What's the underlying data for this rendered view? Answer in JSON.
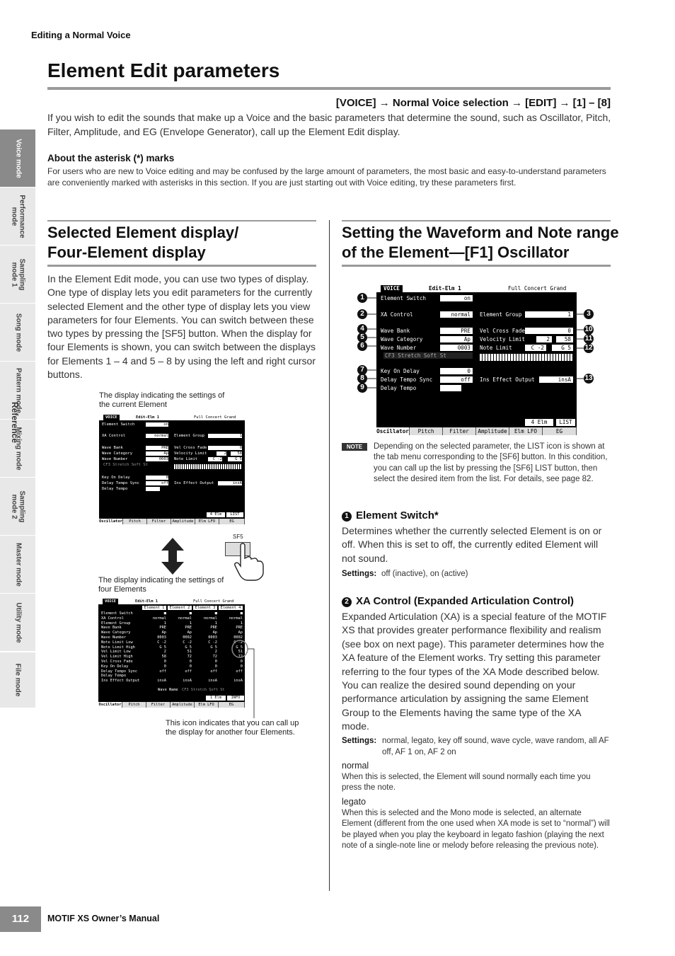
{
  "running_head": "Editing a Normal Voice",
  "title": "Element Edit parameters",
  "nav_path": "[VOICE] → Normal Voice selection → [EDIT] → [1] – [8]",
  "intro": "If you wish to edit the sounds that make up a Voice and the basic parameters that determine the sound, such as Oscillator, Pitch, Filter, Amplitude, and EG (Envelope Generator), call up the Element Edit display.",
  "asterisk": {
    "heading": "About the asterisk (*) marks",
    "body": "For users who are new to Voice editing and may be confused by the large amount of parameters, the most basic and easy-to-understand parameters are conveniently marked with asterisks in this section. If you are just starting out with Voice editing, try these parameters first."
  },
  "side_tabs": [
    "Voice mode",
    "Performance\nmode",
    "Sampling\nmode 1",
    "Song mode",
    "Pattern mode",
    "Mixing mode",
    "Sampling\nmode 2",
    "Master mode",
    "Utility mode",
    "File mode"
  ],
  "side_label": "Reference",
  "left": {
    "title_line1": "Selected Element display/",
    "title_line2": "Four-Element display",
    "body": "In the Element Edit mode, you can use two types of display. One type of display lets you edit parameters for the currently selected Element and the other type of display lets you view parameters for four Elements. You can switch between these two types by pressing the [SF5] button. When the display for four Elements is shown, you can switch between the displays for Elements 1 – 4 and 5 – 8 by using the left and right cursor buttons.",
    "caption1_l1": "The display indicating the settings of",
    "caption1_l2": "the current Element",
    "caption2_l1": "The display indicating the settings of",
    "caption2_l2": "four Elements",
    "caption3_l1": "This icon indicates that you can call up",
    "caption3_l2": "the display for another four Elements.",
    "sf5_label": "SF5"
  },
  "lcd": {
    "mode": "VOICE",
    "screen": "Edit-Elm 1",
    "voice_name": "Full Concert Grand",
    "rows": {
      "element_switch": "Element Switch",
      "element_switch_val": "on",
      "xa_control": "XA Control",
      "xa_control_val": "normal",
      "element_group": "Element Group",
      "element_group_val": "1",
      "wave_bank": "Wave Bank",
      "wave_bank_val": "PRE",
      "wave_category": "Wave Category",
      "wave_category_val": "Ap",
      "wave_number": "Wave Number",
      "wave_number_val": "0003",
      "wave_name": "CF3 Stretch Soft St",
      "vel_cross_fade": "Vel Cross Fade",
      "vel_cross_fade_val": "0",
      "velocity_limit": "Velocity Limit",
      "velocity_limit_lo": "2",
      "velocity_limit_hi": "58",
      "note_limit": "Note Limit",
      "note_limit_lo": "C -2",
      "note_limit_hi": "G 5",
      "key_on_delay": "Key On Delay",
      "key_on_delay_val": "0",
      "delay_tempo_sync": "Delay Tempo Sync",
      "delay_tempo_sync_val": "off",
      "delay_tempo": "Delay Tempo",
      "ins_effect_output": "Ins Effect Output",
      "ins_effect_output_val": "insA"
    },
    "f5": "4 Elm",
    "f6": "LIST",
    "tabs": [
      "Oscillator",
      "Pitch",
      "Filter",
      "Amplitude",
      "Elm LFO",
      "EG"
    ]
  },
  "lcd4": {
    "cols": [
      "Element 1",
      "Element 2",
      "Element 3",
      "Element 4"
    ],
    "labels": [
      "Element Switch",
      "XA Control",
      "Element Group",
      "Wave Bank",
      "Wave Category",
      "Wave Number",
      "Note Limit Low",
      "Note Limit High",
      "Vel Limit Low",
      "Vel Limit High",
      "Vel Cross Fade",
      "Key On Delay",
      "Delay Tempo Sync",
      "Delay Tempo",
      "Ins Effect Output"
    ],
    "values": [
      [
        "■",
        "■",
        "■",
        "■"
      ],
      [
        "normal",
        "normal",
        "normal",
        "normal"
      ],
      [
        "1",
        "1",
        "1",
        "1"
      ],
      [
        "PRE",
        "PRE",
        "PRE",
        "PRE"
      ],
      [
        "Ap",
        "Ap",
        "Ap",
        "Ap"
      ],
      [
        "0003",
        "0002",
        "0003",
        "0002"
      ],
      [
        "C -2",
        "C -2",
        "C -2",
        "C -2"
      ],
      [
        "G 5",
        "G 5",
        "G 5",
        "G 5"
      ],
      [
        "2",
        "51",
        "2",
        "51"
      ],
      [
        "58",
        "72",
        "72",
        "72"
      ],
      [
        "0",
        "0",
        "0",
        "0"
      ],
      [
        "0",
        "0",
        "0",
        "0"
      ],
      [
        "off",
        "off",
        "off",
        "off"
      ],
      [
        "",
        "",
        "",
        ""
      ],
      [
        "insA",
        "insA",
        "insA",
        "insA"
      ]
    ],
    "wave_name_label": "Wave Name",
    "wave_name": "CF3 Stretch Soft St",
    "f5": "1 Elm",
    "f6": "INFO"
  },
  "right": {
    "title_line1": "Setting the Waveform and Note range",
    "title_line2": "of the Element—[F1] Oscillator",
    "badges": [
      "1",
      "2",
      "3",
      "4",
      "5",
      "6",
      "7",
      "8",
      "9",
      "10",
      "11",
      "12",
      "13"
    ],
    "note_icon": "NOTE",
    "note": "Depending on the selected parameter, the LIST icon is shown at the tab menu corresponding to the [SF6] button. In this condition, you can call up the list by pressing the [SF6] LIST button, then select the desired item from the list. For details, see page 82.",
    "p1_num": "1",
    "p1_title": "Element Switch*",
    "p1_body": "Determines whether the currently selected Element is on or off. When this is set to off, the currently edited Element will not sound.",
    "p1_settings_label": "Settings:",
    "p1_settings": "off (inactive), on (active)",
    "p2_num": "2",
    "p2_title": "XA Control (Expanded Articulation Control)",
    "p2_body": "Expanded Articulation (XA) is a special feature of the MOTIF XS that provides greater performance flexibility and realism (see box on next page). This parameter determines how the XA feature of the Element works. Try setting this parameter referring to the four types of the XA Mode described below. You can realize the desired sound depending on your performance articulation by assigning the same Element Group to the Elements having the same type of the XA mode.",
    "p2_settings_label": "Settings:",
    "p2_settings": "normal, legato, key off sound, wave cycle, wave random, all AF off, AF 1 on, AF 2 on",
    "opt1_name": "normal",
    "opt1_body": "When this is selected, the Element will sound normally each time you press the note.",
    "opt2_name": "legato",
    "opt2_body": "When this is selected and the Mono mode is selected, an alternate Element (different from the one used when XA mode is set to “normal”) will be played when you play the keyboard in legato fashion (playing the next note of a single-note line or melody before releasing the previous note)."
  },
  "footer": {
    "page": "112",
    "manual": "MOTIF XS Owner’s Manual"
  }
}
